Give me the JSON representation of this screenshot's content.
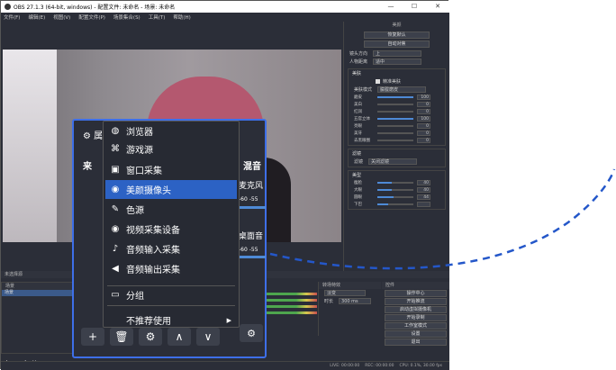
{
  "window": {
    "title": "OBS 27.1.3 (64-bit, windows) - 配置文件: 未命名 - 场景: 未命名"
  },
  "menubar": [
    "文件(F)",
    "编辑(E)",
    "视图(V)",
    "配置文件(P)",
    "场景集合(S)",
    "工具(T)",
    "帮助(H)"
  ],
  "beauty_panel": {
    "title": "美颜",
    "buttons": [
      "恢复默认",
      "自动对焦"
    ],
    "rows": [
      {
        "label": "镜头方向",
        "value": "上"
      },
      {
        "label": "人物距离",
        "value": "适中"
      }
    ],
    "group1_title": "美肤",
    "precise_label": "精准美肤",
    "mode": {
      "label": "美肤模式",
      "value": "朦胧磨皮"
    },
    "sliders": [
      {
        "label": "磨皮",
        "value": "100",
        "pct": 100
      },
      {
        "label": "美白",
        "value": "0",
        "pct": 0
      },
      {
        "label": "红润",
        "value": "0",
        "pct": 0
      },
      {
        "label": "五官立体",
        "value": "100",
        "pct": 100
      },
      {
        "label": "亮眼",
        "value": "0",
        "pct": 0
      },
      {
        "label": "美牙",
        "value": "0",
        "pct": 0
      },
      {
        "label": "去黑眼圈",
        "value": "0",
        "pct": 0
      }
    ],
    "filter_group": {
      "title": "滤镜",
      "label": "滤镜",
      "value": "关闭滤镜"
    },
    "shape_group": {
      "title": "美型",
      "sliders": [
        {
          "label": "瘦脸",
          "value": "40",
          "pct": 40
        },
        {
          "label": "大眼",
          "value": "40",
          "pct": 40
        },
        {
          "label": "圆眼",
          "value": "44",
          "pct": 44
        },
        {
          "label": "下巴",
          "value": "",
          "pct": 30
        }
      ]
    }
  },
  "no_source": "未选择源",
  "scenes": {
    "title": "场景",
    "items": [
      "场景"
    ]
  },
  "transitions": {
    "title": "转场特效",
    "type": "淡变",
    "duration_label": "时长",
    "duration": "300 ms"
  },
  "controls": {
    "title": "控件",
    "buttons": [
      "操作中心",
      "开始推流",
      "启动虚拟摄像机",
      "开始录制",
      "工作室模式",
      "设置",
      "退出"
    ]
  },
  "status": {
    "live": "LIVE: 00:00:00",
    "rec": "REC: 00:00:00",
    "cpu": "CPU: 0.1%, 30.00 fps"
  },
  "popup": {
    "partial_title": "属",
    "left_header": "来",
    "right_header": "混音",
    "mixer_labels": [
      "麦克风",
      "桌面音"
    ],
    "mixer_nums": [
      "-60  -55",
      "-60  -55"
    ],
    "menu_items": [
      {
        "label": "浏览器",
        "icon": "globe-icon"
      },
      {
        "label": "游戏源",
        "icon": "gamepad-icon"
      },
      {
        "label": "窗口采集",
        "icon": "window-icon"
      },
      {
        "label": "美颜摄像头",
        "icon": "camera-icon"
      },
      {
        "label": "色源",
        "icon": "brush-icon"
      },
      {
        "label": "视频采集设备",
        "icon": "camera-icon"
      },
      {
        "label": "音频输入采集",
        "icon": "microphone-icon"
      },
      {
        "label": "音频输出采集",
        "icon": "speaker-icon"
      },
      {
        "label": "分组",
        "icon": "folder-icon"
      },
      {
        "label": "不推荐使用",
        "icon": "none"
      }
    ]
  },
  "colors": {
    "accent": "#3e6fe8",
    "highlight": "#2c62c4",
    "bg": "#2b2e38"
  }
}
